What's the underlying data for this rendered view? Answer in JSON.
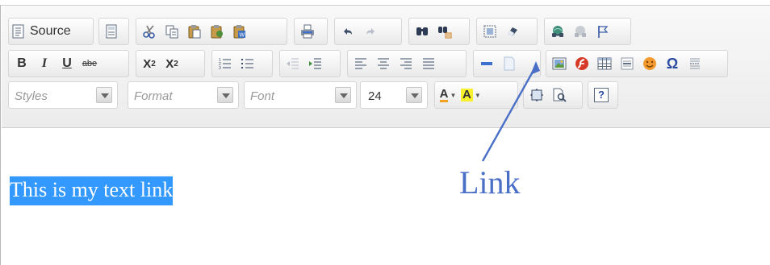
{
  "toolbar": {
    "row1": {
      "source_label": "Source",
      "buttons": [
        "source-icon",
        "templates-icon",
        "cut-icon",
        "copy-icon",
        "paste-icon",
        "paste-text-icon",
        "paste-word-icon",
        "print-icon",
        "undo-icon",
        "redo-icon",
        "find-icon",
        "replace-icon",
        "select-all-icon",
        "remove-format-icon",
        "link-icon",
        "unlink-icon",
        "anchor-icon"
      ]
    },
    "row2": {
      "bold": "B",
      "italic": "I",
      "underline": "U",
      "strike": "abe",
      "subscript": "X",
      "subscript_sub": "2",
      "superscript": "X",
      "superscript_sup": "2",
      "omega": "Ω"
    },
    "row3": {
      "styles_placeholder": "Styles",
      "format_placeholder": "Format",
      "font_placeholder": "Font",
      "size_value": "24",
      "text_color_letter": "A",
      "bg_color_letter": "A",
      "help_label": "?"
    }
  },
  "content": {
    "selected_text": "This is my text link"
  },
  "annotation": {
    "label": "Link",
    "color": "#4a6fc7"
  },
  "colors": {
    "selection": "#3399ff",
    "toolbar_bg": "#f0f0f0"
  }
}
